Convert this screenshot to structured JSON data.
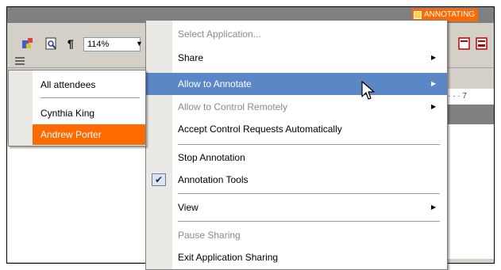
{
  "status_badge": {
    "label": "ANNOTATING"
  },
  "toolbar": {
    "zoom_value": "114%",
    "pilcrow": "¶"
  },
  "ruler": {
    "text": "· · · 7"
  },
  "menu": {
    "items": [
      {
        "label": "Select Application...",
        "enabled": false,
        "submenu": false
      },
      {
        "label": "Share",
        "enabled": true,
        "submenu": true
      },
      {
        "label": "Allow to Annotate",
        "enabled": true,
        "submenu": true,
        "highlighted": true
      },
      {
        "label": "Allow to Control Remotely",
        "enabled": false,
        "submenu": true
      },
      {
        "label": "Accept Control Requests Automatically",
        "enabled": true,
        "submenu": false
      },
      {
        "label": "Stop Annotation",
        "enabled": true,
        "submenu": false
      },
      {
        "label": "Annotation Tools",
        "enabled": true,
        "submenu": false,
        "checked": true
      },
      {
        "label": "View",
        "enabled": true,
        "submenu": true
      },
      {
        "label": "Pause Sharing",
        "enabled": false,
        "submenu": false
      },
      {
        "label": "Exit Application Sharing",
        "enabled": true,
        "submenu": false
      }
    ],
    "check_glyph": "✔",
    "arrow_glyph": "▶"
  },
  "submenu": {
    "items": [
      {
        "label": "All attendees"
      },
      {
        "label": "Cynthia King"
      },
      {
        "label": "Andrew Porter",
        "selected": true
      }
    ]
  },
  "colors": {
    "highlight": "#5b87c7",
    "selected_submenu": "#ff6a00",
    "badge": "#ff6a00",
    "menu_gutter": "#ebe9e3"
  }
}
